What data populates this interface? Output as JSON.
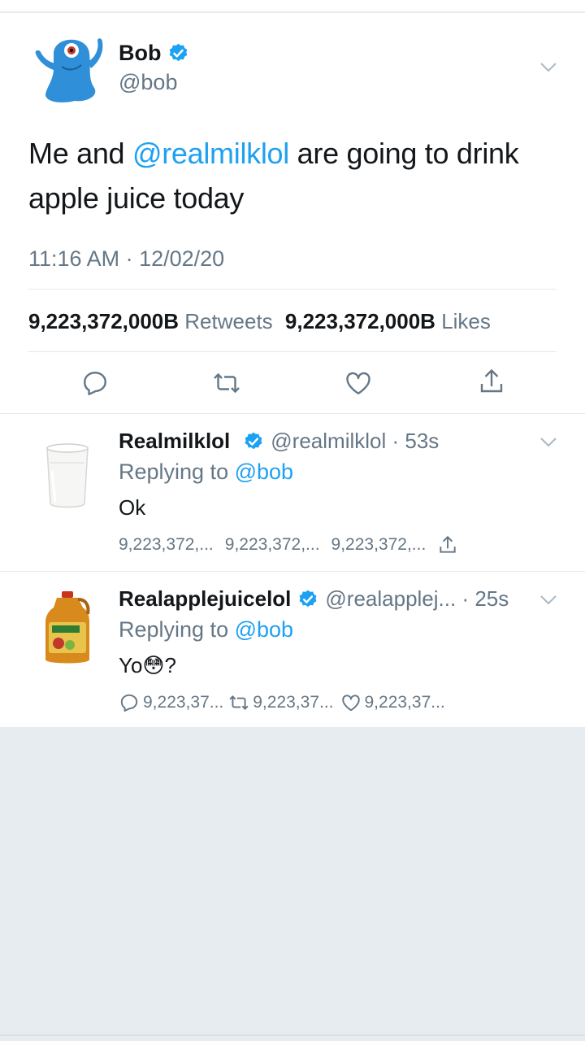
{
  "tweet": {
    "name": "Bob",
    "handle": "@bob",
    "text_before": "Me and ",
    "mention": "@realmilklol",
    "text_after": " are going to drink apple juice today",
    "timestamp": "11:16 AM · 12/02/20",
    "retweets_count": "9,223,372,000B",
    "retweets_label": "Retweets",
    "likes_count": "9,223,372,000B",
    "likes_label": "Likes"
  },
  "replies": [
    {
      "name": "Realmilklol",
      "handle_time": "@realmilklol · 53s",
      "replying_label": "Replying to",
      "replying_handle": "@bob",
      "text": "Ok",
      "stats": [
        "9,223,372,...",
        "9,223,372,...",
        "9,223,372,..."
      ]
    },
    {
      "name": "Realapplejuicelol",
      "handle_time": "@realapplej... · 25s",
      "replying_label": "Replying to",
      "replying_handle": "@bob",
      "text_before": "Yo",
      "emoji": "😳",
      "text_after": "?",
      "stats": [
        "9,223,37...",
        "9,223,37...",
        "9,223,37..."
      ]
    }
  ],
  "colors": {
    "accent": "#1da1f2",
    "muted": "#657786",
    "text": "#14171a",
    "background": "#e6ecf0"
  },
  "icons": [
    "verified-badge-icon",
    "chevron-down-icon",
    "reply-icon",
    "retweet-icon",
    "like-icon",
    "share-icon"
  ]
}
